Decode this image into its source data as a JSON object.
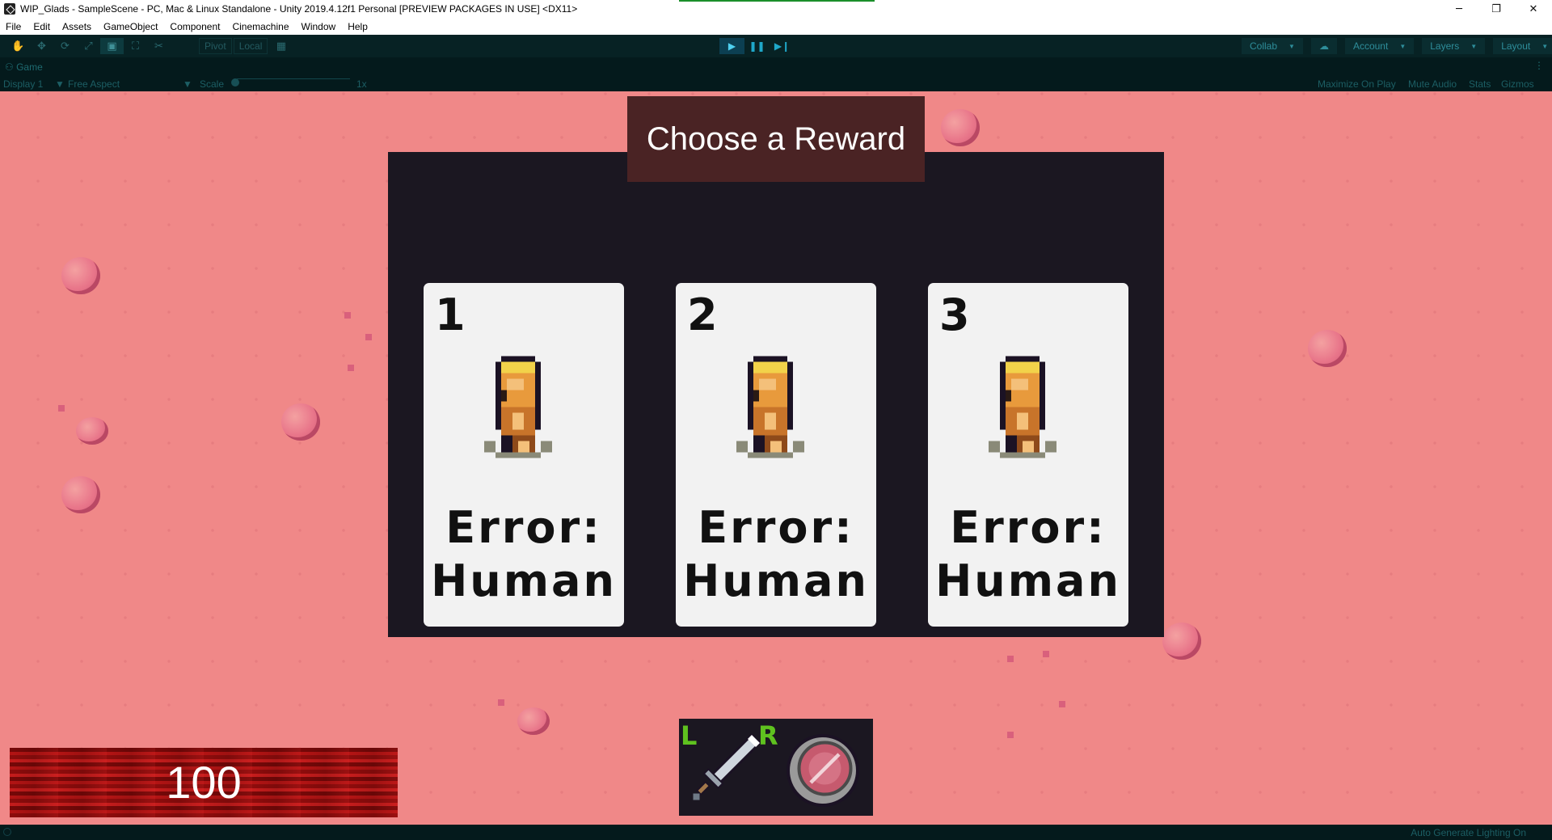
{
  "window": {
    "title": "WIP_Glads - SampleScene - PC, Mac & Linux Standalone - Unity 2019.4.12f1 Personal [PREVIEW PACKAGES IN USE] <DX11>",
    "controls": {
      "minimize": "─",
      "restore": "❐",
      "close": "✕"
    }
  },
  "menu": [
    "File",
    "Edit",
    "Assets",
    "GameObject",
    "Component",
    "Cinemachine",
    "Window",
    "Help"
  ],
  "toolbar": {
    "tools": [
      {
        "name": "hand-tool-icon",
        "glyph": "✋"
      },
      {
        "name": "move-tool-icon",
        "glyph": "✥"
      },
      {
        "name": "rotate-tool-icon",
        "glyph": "⟳"
      },
      {
        "name": "scale-tool-icon",
        "glyph": "⤢"
      },
      {
        "name": "rect-tool-icon",
        "glyph": "▣"
      },
      {
        "name": "transform-tool-icon",
        "glyph": "⛶"
      },
      {
        "name": "custom-tool-icon",
        "glyph": "✂"
      }
    ],
    "pivot_label": "Pivot",
    "local_label": "Local",
    "grid_icon": "▦",
    "play": "▶",
    "pause": "❚❚",
    "step": "▶❙",
    "collab_label": "Collab",
    "cloud_icon": "☁",
    "account_label": "Account",
    "layers_label": "Layers",
    "layout_label": "Layout"
  },
  "game_view": {
    "tab_label": "Game",
    "display": "Display 1",
    "aspect": "Free Aspect",
    "scale_label": "Scale",
    "scale_value": "1x",
    "maximize": "Maximize On Play",
    "mute": "Mute Audio",
    "stats": "Stats",
    "gizmos": "Gizmos"
  },
  "reward_dialog": {
    "title": "Choose a Reward",
    "cards": [
      {
        "number": "1",
        "name_line1": "Error:",
        "name_line2": "Human"
      },
      {
        "number": "2",
        "name_line1": "Error:",
        "name_line2": "Human"
      },
      {
        "number": "3",
        "name_line1": "Error:",
        "name_line2": "Human"
      }
    ]
  },
  "hud": {
    "health": "100",
    "left_slot_key": "L",
    "right_slot_key": "R",
    "left_weapon": "sword-icon",
    "right_weapon": "shield-icon"
  },
  "status": {
    "right_text": "Auto Generate Lighting On"
  },
  "colors": {
    "ground": "#f08888",
    "dialog_bg": "#1b1721",
    "title_bg": "#4a2324",
    "card_bg": "#f2f2f2",
    "health_red": "#b41414",
    "key_green": "#5fc21f"
  }
}
